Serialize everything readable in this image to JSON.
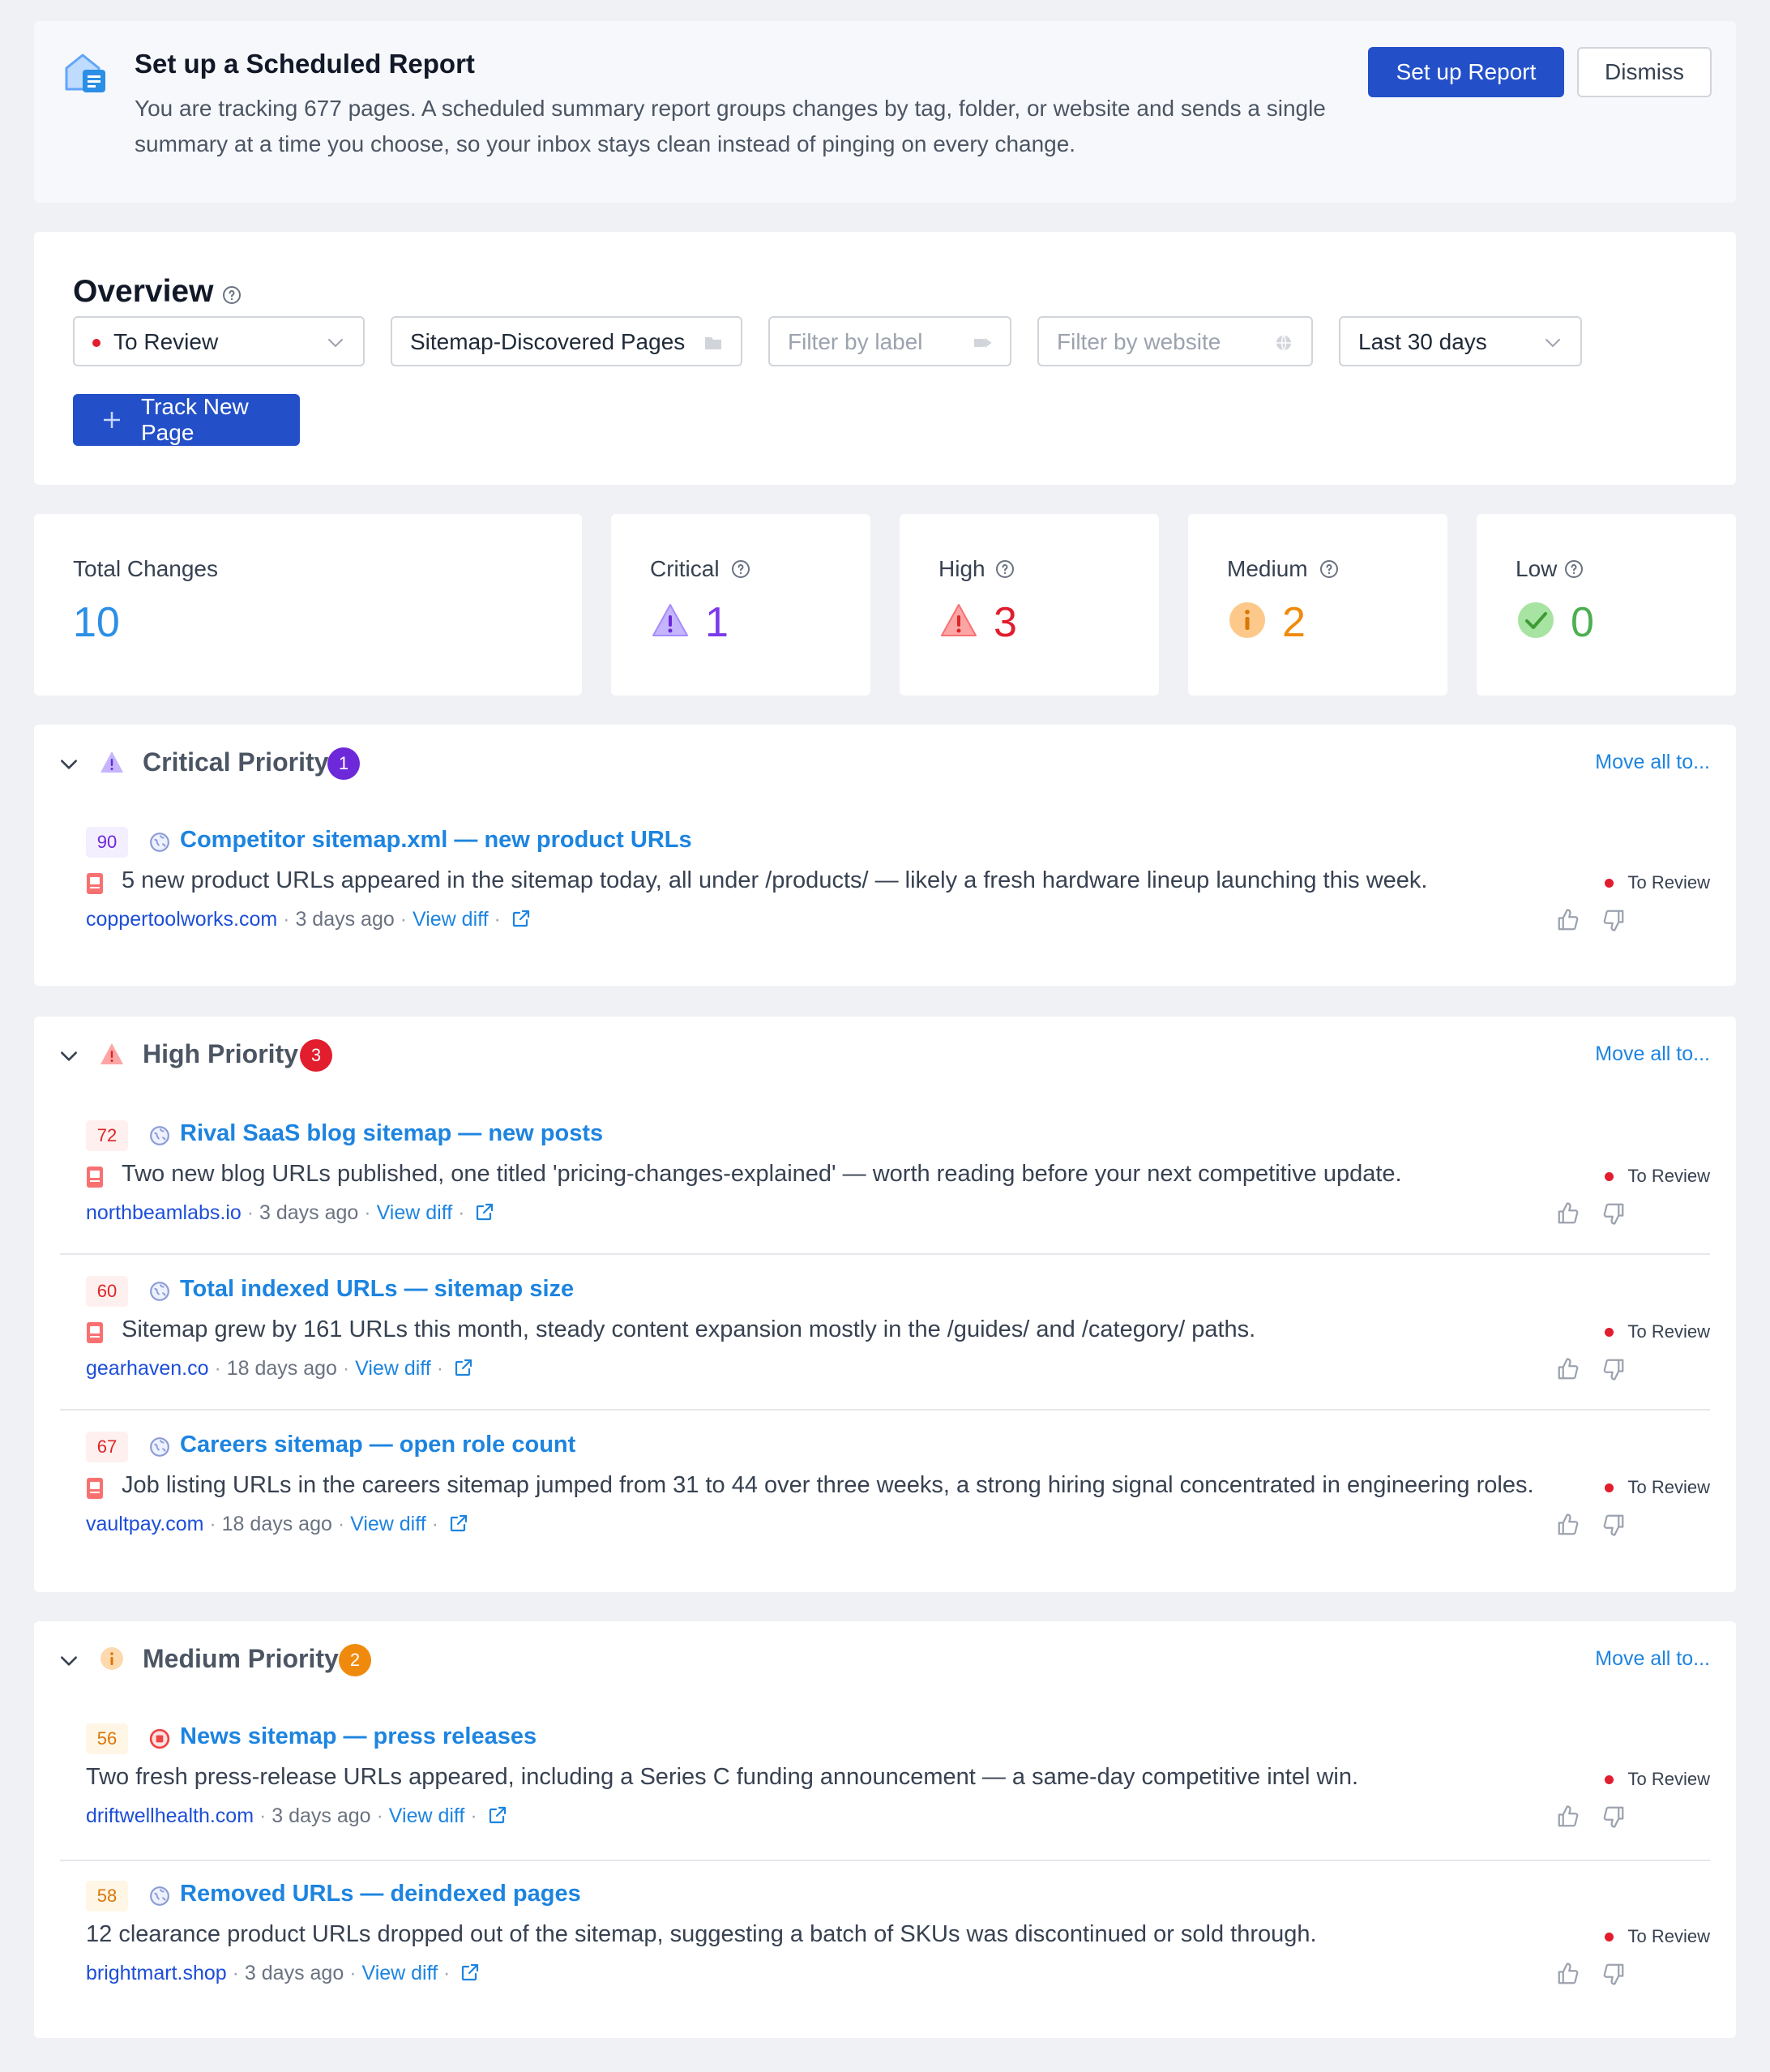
{
  "banner": {
    "title": "Set up a Scheduled Report",
    "text": "You are tracking 677 pages. A scheduled summary report groups changes by tag, folder, or website and sends a single summary at a time you choose, so your inbox stays clean instead of pinging on every change.",
    "setup_label": "Set up Report",
    "dismiss_label": "Dismiss"
  },
  "overview": {
    "title": "Overview",
    "status_filter": "To Review",
    "sitemap_filter": "Sitemap-Discovered Pages",
    "label_placeholder": "Filter by label",
    "website_placeholder": "Filter by website",
    "date_filter": "Last 30 days",
    "track_label": "Track New Page"
  },
  "stats": {
    "total": {
      "label": "Total Changes",
      "value": "10"
    },
    "critical": {
      "label": "Critical",
      "value": "1"
    },
    "high": {
      "label": "High",
      "value": "3"
    },
    "medium": {
      "label": "Medium",
      "value": "2"
    },
    "low": {
      "label": "Low",
      "value": "0"
    }
  },
  "colors": {
    "critical": "#7c3aed",
    "high": "#e11d2e",
    "medium": "#f08a0c",
    "low": "#4caf50",
    "link": "#1d84e0"
  },
  "sections": {
    "critical": {
      "title": "Critical Priority",
      "count": "1",
      "move_label": "Move all to...",
      "items": [
        {
          "score": "90",
          "title": "Competitor sitemap.xml — new product URLs",
          "desc": "5 new product URLs appeared in the sitemap today, all under /products/ — likely a fresh hardware lineup launching this week.",
          "domain": "coppertoolworks.com",
          "time": "3 days ago",
          "diff": "View diff",
          "status": "To Review"
        }
      ]
    },
    "high": {
      "title": "High Priority",
      "count": "3",
      "move_label": "Move all to...",
      "items": [
        {
          "score": "72",
          "title": "Rival SaaS blog sitemap — new posts",
          "desc": "Two new blog URLs published, one titled 'pricing-changes-explained' — worth reading before your next competitive update.",
          "domain": "northbeamlabs.io",
          "time": "3 days ago",
          "diff": "View diff",
          "status": "To Review"
        },
        {
          "score": "60",
          "title": "Total indexed URLs — sitemap size",
          "desc": "Sitemap grew by 161 URLs this month, steady content expansion mostly in the /guides/ and /category/ paths.",
          "domain": "gearhaven.co",
          "time": "18 days ago",
          "diff": "View diff",
          "status": "To Review"
        },
        {
          "score": "67",
          "title": "Careers sitemap — open role count",
          "desc": "Job listing URLs in the careers sitemap jumped from 31 to 44 over three weeks, a strong hiring signal concentrated in engineering roles.",
          "domain": "vaultpay.com",
          "time": "18 days ago",
          "diff": "View diff",
          "status": "To Review"
        }
      ]
    },
    "medium": {
      "title": "Medium Priority",
      "count": "2",
      "move_label": "Move all to...",
      "items": [
        {
          "score": "56",
          "title": "News sitemap — press releases",
          "desc": "Two fresh press-release URLs appeared, including a Series C funding announcement — a same-day competitive intel win.",
          "domain": "driftwellhealth.com",
          "time": "3 days ago",
          "diff": "View diff",
          "status": "To Review"
        },
        {
          "score": "58",
          "title": "Removed URLs — deindexed pages",
          "desc": "12 clearance product URLs dropped out of the sitemap, suggesting a batch of SKUs was discontinued or sold through.",
          "domain": "brightmart.shop",
          "time": "3 days ago",
          "diff": "View diff",
          "status": "To Review"
        }
      ]
    }
  }
}
